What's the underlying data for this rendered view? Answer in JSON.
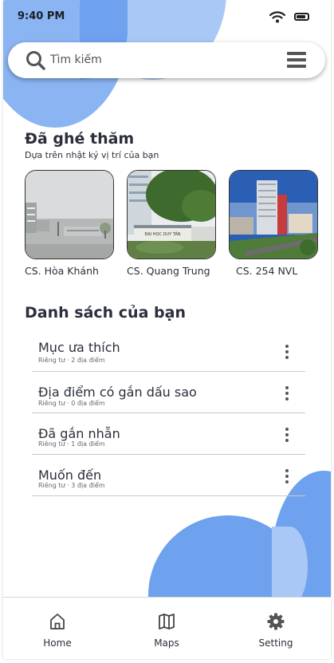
{
  "status_bar": {
    "time": "9:40 PM"
  },
  "search": {
    "placeholder": "Tìm kiếm"
  },
  "visited": {
    "title": "Đã ghé thăm",
    "subtitle": "Dựa trên nhật ký vị trí của bạn",
    "places": [
      {
        "label": "CS. Hòa Khánh"
      },
      {
        "label": "CS. Quang Trung",
        "sign_text": "ĐẠI HỌC DUY TÂN"
      },
      {
        "label": "CS. 254 NVL"
      }
    ]
  },
  "lists": {
    "title": "Danh sách của bạn",
    "items": [
      {
        "title": "Mục ưa thích",
        "meta": "Riêng tư · 2 địa điểm"
      },
      {
        "title": "Địa điểm có gắn dấu sao",
        "meta": "Riêng tư · 0 địa điểm"
      },
      {
        "title": "Đã gắn nhẵn",
        "meta": "Riêng tư · 1 địa điểm"
      },
      {
        "title": "Muốn đến",
        "meta": "Riêng tư · 3 địa điểm"
      }
    ]
  },
  "bottom_nav": {
    "items": [
      {
        "label": "Home",
        "icon": "home-icon"
      },
      {
        "label": "Maps",
        "icon": "map-icon"
      },
      {
        "label": "Setting",
        "icon": "gear-icon"
      }
    ]
  },
  "colors": {
    "accent_blue": "#6ea1ee",
    "light_blue": "#a9c8f5",
    "text": "#2b2f3a"
  }
}
